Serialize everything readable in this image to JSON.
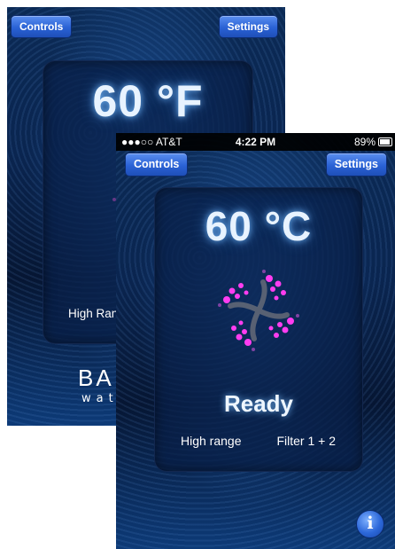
{
  "back_screen": {
    "controls_label": "Controls",
    "settings_label": "Settings",
    "temperature": "60 °F",
    "range_label": "High Ran",
    "brand_main": "BA",
    "brand_sub": "wat"
  },
  "front_screen": {
    "status_bar": {
      "carrier": "●●●○○ AT&T",
      "time": "4:22 PM",
      "battery": "89%"
    },
    "controls_label": "Controls",
    "settings_label": "Settings",
    "temperature": "60 °C",
    "status": "Ready",
    "range_label": "High range",
    "filter_label": "Filter 1 + 2",
    "info_icon_glyph": "i"
  },
  "colors": {
    "button_blue": "#2a62d5",
    "flower_pink": "#ff3df0"
  }
}
